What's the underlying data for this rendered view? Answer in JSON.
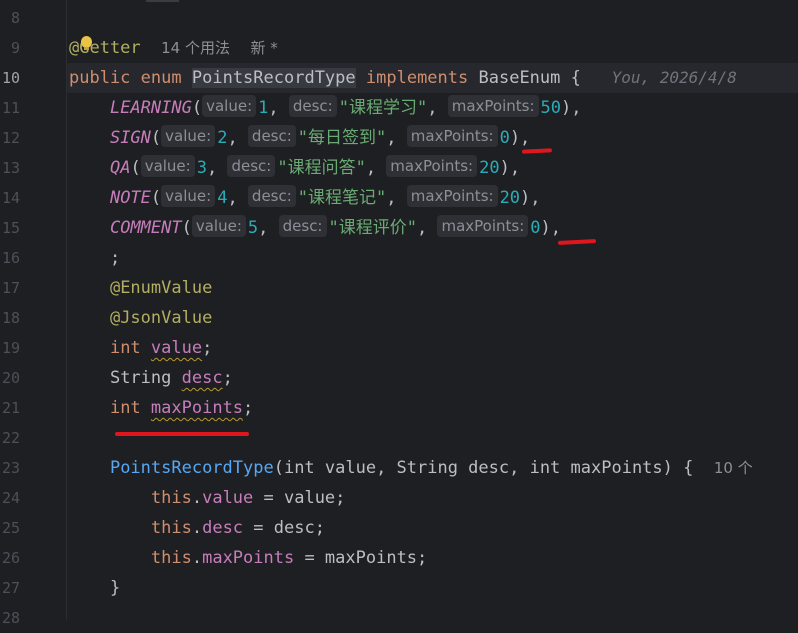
{
  "gutter": {
    "lines": [
      "8",
      "9",
      "10",
      "11",
      "12",
      "13",
      "14",
      "15",
      "16",
      "17",
      "18",
      "19",
      "20",
      "21",
      "22",
      "23",
      "24",
      "25",
      "26",
      "27",
      "28"
    ]
  },
  "header": {
    "annotation": "@Getter",
    "usages": "14 个用法",
    "new_badge": "新 *"
  },
  "line10": {
    "public": "public",
    "enum": "enum",
    "type_name": "PointsRecordType",
    "implements": "implements",
    "base": "BaseEnum",
    "brace": " {",
    "blame": "You, 2026/4/8"
  },
  "enum_entries": [
    {
      "name": "LEARNING",
      "value": "1",
      "desc": "\"课程学习\"",
      "max": "50"
    },
    {
      "name": "SIGN",
      "value": "2",
      "desc": "\"每日签到\"",
      "max": "0"
    },
    {
      "name": "QA",
      "value": "3",
      "desc": "\"课程问答\"",
      "max": "20"
    },
    {
      "name": "NOTE",
      "value": "4",
      "desc": "\"课程笔记\"",
      "max": "20"
    },
    {
      "name": "COMMENT",
      "value": "5",
      "desc": "\"课程评价\"",
      "max": "0"
    }
  ],
  "hints": {
    "value": "value:",
    "desc": "desc:",
    "max": "maxPoints:"
  },
  "semicolon": ";",
  "annotations": {
    "enum_value": "@EnumValue",
    "json_value": "@JsonValue"
  },
  "fields": [
    {
      "type": "int",
      "name": "value"
    },
    {
      "type": "String",
      "name": "desc"
    },
    {
      "type": "int",
      "name": "maxPoints"
    }
  ],
  "constructor": {
    "name": "PointsRecordType",
    "params": "(int value, String desc, int maxPoints) {",
    "usages": "10 个"
  },
  "body": [
    {
      "this": "this",
      "field": "value",
      "rhs": " = value;"
    },
    {
      "this": "this",
      "field": "desc",
      "rhs": " = desc;"
    },
    {
      "this": "this",
      "field": "maxPoints",
      "rhs": " = maxPoints;"
    }
  ],
  "close_brace": "}",
  "colors": {
    "marker": "#e0161e",
    "background": "#1e1f22"
  }
}
